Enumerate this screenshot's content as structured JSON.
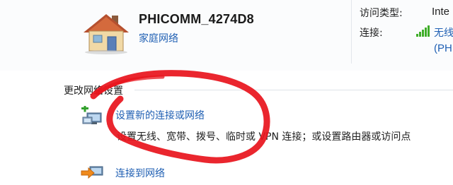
{
  "network": {
    "name": "PHICOMM_4274D8",
    "type_link": "家庭网络",
    "icon": "house-icon"
  },
  "details": {
    "access_type_label": "访问类型:",
    "access_type_value": "Inte",
    "connection_label": "连接:",
    "connection_value": "无线",
    "connection_ssid": "(PH",
    "signal_icon": "wireless-signal-icon"
  },
  "section": {
    "title": "更改网络设置"
  },
  "tasks": [
    {
      "link": "设置新的连接或网络",
      "description": "设置无线、宽带、拨号、临时或 VPN 连接；或设置路由器或访问点",
      "icon": "setup-connection-icon"
    },
    {
      "link": "连接到网络",
      "icon": "connect-network-icon"
    }
  ],
  "colors": {
    "link": "#1f5fb3",
    "scribble": "#e8141c",
    "signal": "#3fae29"
  }
}
